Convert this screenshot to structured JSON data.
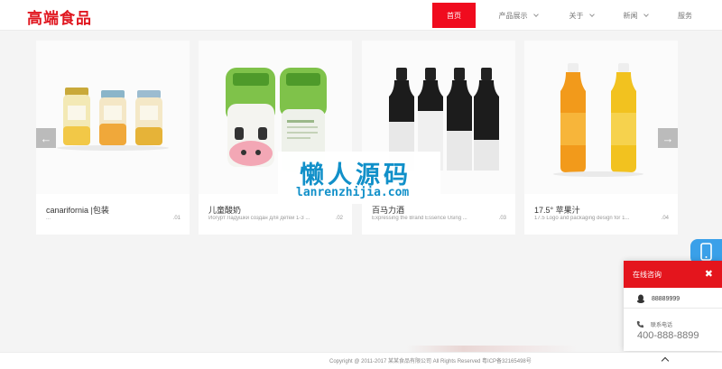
{
  "brand": {
    "logo_text": "高端食品",
    "accent": "#f00b1e"
  },
  "nav": [
    {
      "label": "首页",
      "active": true,
      "dropdown": false
    },
    {
      "label": "产品展示",
      "active": false,
      "dropdown": true
    },
    {
      "label": "关于",
      "active": false,
      "dropdown": true
    },
    {
      "label": "新闻",
      "active": false,
      "dropdown": true
    },
    {
      "label": "服务",
      "active": false,
      "dropdown": false
    }
  ],
  "carousel": {
    "prev_icon": "arrow-left-icon",
    "next_icon": "arrow-right-icon",
    "prev_glyph": "←",
    "next_glyph": "→",
    "items": [
      {
        "title": "canarifornia |包装",
        "sub": "...",
        "num": ".01",
        "image": "honey-jars"
      },
      {
        "title": "儿童酸奶",
        "sub": "Йогурт Ладушки создан для детей 1-3 ...",
        "num": ".02",
        "image": "cow-yogurt-pack"
      },
      {
        "title": "百马力酒",
        "sub": "Expressing the Brand Essence Using ...",
        "num": ".03",
        "image": "black-white-bottles"
      },
      {
        "title": "17.5° 苹果汁",
        "sub": "17.5 Logo and packaging design for 1...",
        "num": ".04",
        "image": "orange-juice-bottles"
      }
    ]
  },
  "watermark": {
    "title": "懒人源码",
    "url": "lanrenzhijia.com"
  },
  "consult": {
    "title": "在线咨询",
    "close_glyph": "✖",
    "qq": "88889999",
    "tel_label": "联系电话",
    "tel": "400-888-8899"
  },
  "footer": {
    "copyright": "Copyright @ 2011-2017 某某食品有限公司 All Rights Reserved    粤ICP备32165498号"
  }
}
